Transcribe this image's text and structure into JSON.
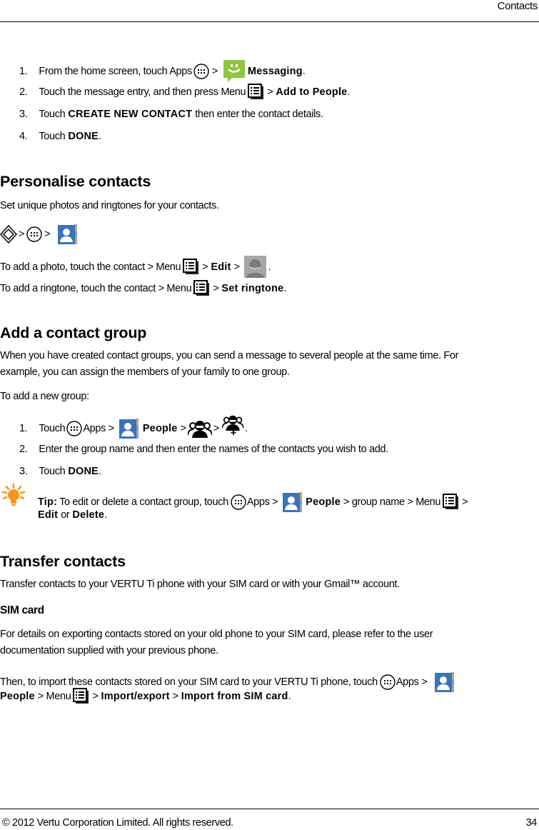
{
  "header": {
    "running_title": "Contacts"
  },
  "steps_intro": [
    {
      "num": "1.",
      "parts": {
        "a": "From the home screen, touch Apps",
        "b": ">",
        "c": "Messaging",
        "d": "."
      }
    },
    {
      "num": "2.",
      "parts": {
        "a": "Touch the message entry, and then press Menu",
        "b": ">",
        "c": "Add to People",
        "d": "."
      }
    },
    {
      "num": "3.",
      "parts": {
        "a": "Touch",
        "b": "CREATE NEW CONTACT",
        "c": "then enter the contact details."
      }
    },
    {
      "num": "4.",
      "parts": {
        "a": "Touch",
        "b": "DONE",
        "c": "."
      }
    }
  ],
  "personalise": {
    "heading": "Personalise contacts",
    "intro": "Set unique photos and ringtones for your contacts.",
    "path_sep": ">",
    "photo": {
      "a": "To add a photo, touch the contact > Menu",
      "b": ">",
      "c": "Edit",
      "d": ">",
      "e": "."
    },
    "ringtone": {
      "a": "To add a ringtone, touch the contact > Menu",
      "b": ">",
      "c": "Set ringtone",
      "d": "."
    }
  },
  "group": {
    "heading": "Add a contact group",
    "para1_l1": "When you have created contact groups, you can send a message to several people at the same time. For",
    "para1_l2": "example, you can assign the members of your family to one group.",
    "para2": "To add a new group:",
    "step1": {
      "num": "1.",
      "a": "Touch",
      "b": "Apps >",
      "c": "People",
      "d": ">",
      "e": ">",
      "f": "."
    },
    "step2": {
      "num": "2.",
      "text": "Enter the group name and then enter the names of the contacts you wish to add."
    },
    "step3": {
      "num": "3.",
      "a": "Touch",
      "b": "DONE",
      "c": "."
    },
    "tip": {
      "label": "Tip:",
      "a": "To edit or delete a contact group, touch",
      "b": "Apps >",
      "c": "People",
      "d": "> group name > Menu",
      "e": ">",
      "f": "Edit",
      "g": "or",
      "h": "Delete",
      "i": "."
    }
  },
  "transfer": {
    "heading": "Transfer contacts",
    "intro": "Transfer contacts to your VERTU Ti phone with your SIM card or with your Gmail™ account.",
    "sim_heading": "SIM card",
    "sim_para_l1": "For details on exporting contacts stored on your old phone to your SIM card, please refer to the user",
    "sim_para_l2": "documentation supplied with your previous phone.",
    "import_l1": {
      "a": "Then, to import these contacts stored on your SIM card to your VERTU Ti phone, touch",
      "b": "Apps >"
    },
    "import_l2": {
      "a": "People",
      "b": "> Menu",
      "c": ">",
      "d": "Import/export",
      "e": ">",
      "f": "Import from SIM card",
      "g": "."
    }
  },
  "footer": {
    "copyright": "© 2012 Vertu Corporation Limited. All rights reserved.",
    "page_number": "34"
  },
  "colors": {
    "messaging_green": "#8dc63f",
    "people_blue": "#3b73b9",
    "tip_orange": "#f7941d",
    "avatar_gray": "#a6a6a6"
  }
}
